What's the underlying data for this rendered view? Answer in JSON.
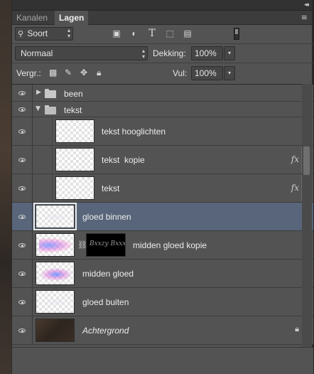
{
  "tabs": [
    {
      "label": "Kanalen",
      "active": false
    },
    {
      "label": "Lagen",
      "active": true
    }
  ],
  "collapse_glyph": "◂◂",
  "menu_glyph": "≡",
  "filter": {
    "kind_label": "Soort",
    "icons": [
      "image-filter-icon",
      "adjustment-filter-icon",
      "type-filter-icon",
      "shape-filter-icon",
      "smart-object-filter-icon"
    ]
  },
  "blend": {
    "mode": "Normaal",
    "opacity_label": "Dekking:",
    "opacity_value": "100%",
    "fill_label": "Vul:",
    "fill_value": "100%"
  },
  "lock": {
    "label": "Vergr.:",
    "icons": [
      "lock-transparency-icon",
      "lock-paint-icon",
      "lock-position-icon",
      "lock-all-icon"
    ]
  },
  "layers": [
    {
      "name": "been",
      "type": "group",
      "expanded": false
    },
    {
      "name": "tekst",
      "type": "group",
      "expanded": true
    },
    {
      "name": "tekst hooglichten",
      "type": "layer",
      "indented": true,
      "fx": false
    },
    {
      "name": "tekst  kopie",
      "type": "layer",
      "indented": true,
      "fx": true,
      "fx_label": "fx"
    },
    {
      "name": "tekst",
      "type": "layer",
      "indented": true,
      "fx": true,
      "fx_label": "fx"
    },
    {
      "name": "gloed binnen",
      "type": "layer",
      "selected": true
    },
    {
      "name": "midden gloed kopie",
      "type": "layer",
      "mask": true,
      "mask_text": "Bxxzy Bxxxt"
    },
    {
      "name": "midden gloed",
      "type": "layer"
    },
    {
      "name": "gloed buiten",
      "type": "layer"
    },
    {
      "name": "Achtergrond",
      "type": "background",
      "locked": true
    }
  ]
}
